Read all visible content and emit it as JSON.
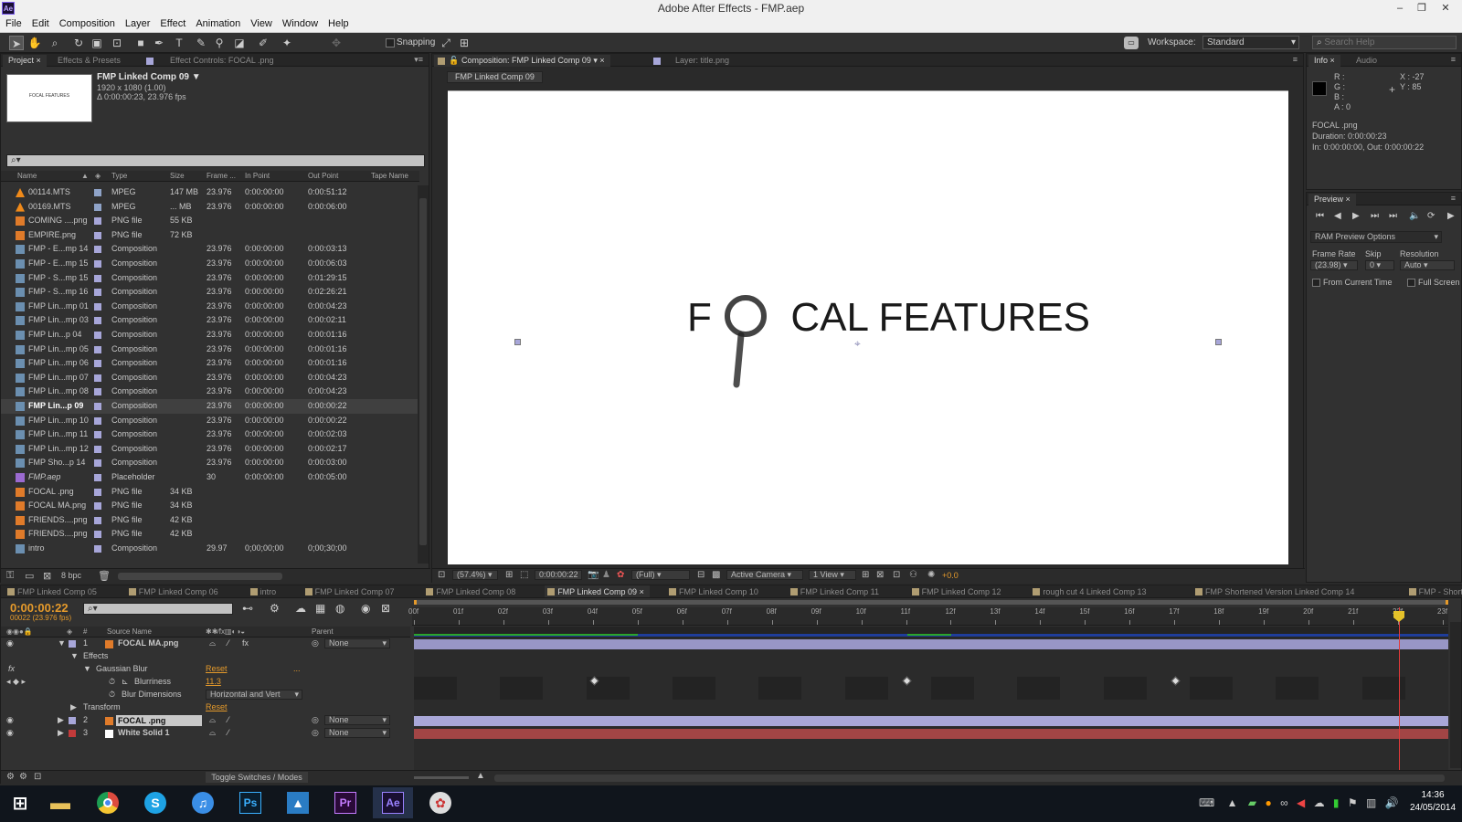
{
  "window": {
    "title": "Adobe After Effects - FMP.aep",
    "app_icon": "Ae"
  },
  "menu": [
    "File",
    "Edit",
    "Composition",
    "Layer",
    "Effect",
    "Animation",
    "View",
    "Window",
    "Help"
  ],
  "toolbar": {
    "snapping": "Snapping",
    "workspace_label": "Workspace:",
    "workspace_value": "Standard",
    "search_placeholder": "Search Help"
  },
  "project": {
    "tabs": [
      "Project",
      "Effects & Presets",
      "Effect Controls: FOCAL .png"
    ],
    "comp_name": "FMP Linked Comp 09 ▼",
    "comp_res": "1920 x 1080 (1.00)",
    "comp_dur": "Δ 0:00:00:23, 23.976 fps",
    "thumb_text": "FOCAL FEATURES",
    "search": "",
    "columns": [
      "Name",
      "Type",
      "Size",
      "Frame ...",
      "In Point",
      "Out Point",
      "Tape Name"
    ],
    "items": [
      {
        "name": "00114.MTS",
        "type": "MPEG",
        "size": "147 MB",
        "fps": "23.976",
        "in": "0:00:00:00",
        "out": "0:00:51:12",
        "icon": "cone-icon",
        "label": "#8fa3c8"
      },
      {
        "name": "00169.MTS",
        "type": "MPEG",
        "size": "... MB",
        "fps": "23.976",
        "in": "0:00:00:00",
        "out": "0:00:06:00",
        "icon": "cone-icon",
        "label": "#8fa3c8"
      },
      {
        "name": "COMING ....png",
        "type": "PNG file",
        "size": "55 KB",
        "fps": "",
        "in": "",
        "out": "",
        "icon": "png-icon",
        "label": "#a7a6d9"
      },
      {
        "name": "EMPIRE.png",
        "type": "PNG file",
        "size": "72 KB",
        "fps": "",
        "in": "",
        "out": "",
        "icon": "png-icon",
        "label": "#a7a6d9"
      },
      {
        "name": "FMP - E...mp 14",
        "type": "Composition",
        "size": "",
        "fps": "23.976",
        "in": "0:00:00:00",
        "out": "0:00:03:13",
        "icon": "comp-icon",
        "label": "#a7a6d9"
      },
      {
        "name": "FMP - E...mp 15",
        "type": "Composition",
        "size": "",
        "fps": "23.976",
        "in": "0:00:00:00",
        "out": "0:00:06:03",
        "icon": "comp-icon",
        "label": "#a7a6d9"
      },
      {
        "name": "FMP - S...mp 15",
        "type": "Composition",
        "size": "",
        "fps": "23.976",
        "in": "0:00:00:00",
        "out": "0:01:29:15",
        "icon": "comp-icon",
        "label": "#a7a6d9"
      },
      {
        "name": "FMP - S...mp 16",
        "type": "Composition",
        "size": "",
        "fps": "23.976",
        "in": "0:00:00:00",
        "out": "0:02:26:21",
        "icon": "comp-icon",
        "label": "#a7a6d9"
      },
      {
        "name": "FMP Lin...mp 01",
        "type": "Composition",
        "size": "",
        "fps": "23.976",
        "in": "0:00:00:00",
        "out": "0:00:04:23",
        "icon": "comp-icon",
        "label": "#a7a6d9"
      },
      {
        "name": "FMP Lin...mp 03",
        "type": "Composition",
        "size": "",
        "fps": "23.976",
        "in": "0:00:00:00",
        "out": "0:00:02:11",
        "icon": "comp-icon",
        "label": "#a7a6d9"
      },
      {
        "name": "FMP Lin...p 04",
        "type": "Composition",
        "size": "",
        "fps": "23.976",
        "in": "0:00:00:00",
        "out": "0:00:01:16",
        "icon": "comp-icon",
        "label": "#a7a6d9"
      },
      {
        "name": "FMP Lin...mp 05",
        "type": "Composition",
        "size": "",
        "fps": "23.976",
        "in": "0:00:00:00",
        "out": "0:00:01:16",
        "icon": "comp-icon",
        "label": "#a7a6d9"
      },
      {
        "name": "FMP Lin...mp 06",
        "type": "Composition",
        "size": "",
        "fps": "23.976",
        "in": "0:00:00:00",
        "out": "0:00:01:16",
        "icon": "comp-icon",
        "label": "#a7a6d9"
      },
      {
        "name": "FMP Lin...mp 07",
        "type": "Composition",
        "size": "",
        "fps": "23.976",
        "in": "0:00:00:00",
        "out": "0:00:04:23",
        "icon": "comp-icon",
        "label": "#a7a6d9"
      },
      {
        "name": "FMP Lin...mp 08",
        "type": "Composition",
        "size": "",
        "fps": "23.976",
        "in": "0:00:00:00",
        "out": "0:00:04:23",
        "icon": "comp-icon",
        "label": "#a7a6d9"
      },
      {
        "name": "FMP Lin...p 09",
        "type": "Composition",
        "size": "",
        "fps": "23.976",
        "in": "0:00:00:00",
        "out": "0:00:00:22",
        "icon": "comp-icon",
        "label": "#a7a6d9",
        "selected": true
      },
      {
        "name": "FMP Lin...mp 10",
        "type": "Composition",
        "size": "",
        "fps": "23.976",
        "in": "0:00:00:00",
        "out": "0:00:00:22",
        "icon": "comp-icon",
        "label": "#a7a6d9"
      },
      {
        "name": "FMP Lin...mp 11",
        "type": "Composition",
        "size": "",
        "fps": "23.976",
        "in": "0:00:00:00",
        "out": "0:00:02:03",
        "icon": "comp-icon",
        "label": "#a7a6d9"
      },
      {
        "name": "FMP Lin...mp 12",
        "type": "Composition",
        "size": "",
        "fps": "23.976",
        "in": "0:00:00:00",
        "out": "0:00:02:17",
        "icon": "comp-icon",
        "label": "#a7a6d9"
      },
      {
        "name": "FMP Sho...p 14",
        "type": "Composition",
        "size": "",
        "fps": "23.976",
        "in": "0:00:00:00",
        "out": "0:00:03:00",
        "icon": "comp-icon",
        "label": "#a7a6d9"
      },
      {
        "name": "FMP.aep",
        "type": "Placeholder",
        "size": "",
        "fps": "30",
        "in": "0:00:00:00",
        "out": "0:00:05:00",
        "icon": "placeholder-icon",
        "label": "#a7a6d9"
      },
      {
        "name": "FOCAL .png",
        "type": "PNG file",
        "size": "34 KB",
        "fps": "",
        "in": "",
        "out": "",
        "icon": "png-icon",
        "label": "#a7a6d9"
      },
      {
        "name": "FOCAL MA.png",
        "type": "PNG file",
        "size": "34 KB",
        "fps": "",
        "in": "",
        "out": "",
        "icon": "png-icon",
        "label": "#a7a6d9"
      },
      {
        "name": "FRIENDS....png",
        "type": "PNG file",
        "size": "42 KB",
        "fps": "",
        "in": "",
        "out": "",
        "icon": "png-icon",
        "label": "#a7a6d9"
      },
      {
        "name": "FRIENDS....png",
        "type": "PNG file",
        "size": "42 KB",
        "fps": "",
        "in": "",
        "out": "",
        "icon": "png-icon",
        "label": "#a7a6d9"
      },
      {
        "name": "intro",
        "type": "Composition",
        "size": "",
        "fps": "29.97",
        "in": "0;00;00;00",
        "out": "0;00;30;00",
        "icon": "comp-icon",
        "label": "#a7a6d9"
      }
    ],
    "bpc": "8 bpc"
  },
  "comp": {
    "tabs": [
      "Composition: FMP Linked Comp 09",
      "Layer: title.png"
    ],
    "breadcrumb": "FMP Linked Comp 09",
    "canvas_text_left": "F",
    "canvas_text_right": "CAL FEATURES",
    "zoom": "(57.4%)",
    "timecode": "0:00:00:22",
    "resolution": "(Full)",
    "camera": "Active Camera",
    "views": "1 View",
    "exposure": "+0.0"
  },
  "info": {
    "tabs": [
      "Info",
      "Audio"
    ],
    "r": "R :",
    "g": "G :",
    "b": "B :",
    "a": "A : 0",
    "x": "X : -27",
    "y": "Y : 85",
    "layer": "FOCAL .png",
    "duration": "Duration: 0:00:00:23",
    "inout": "In: 0:00:00:00, Out: 0:00:00:22"
  },
  "preview": {
    "tab": "Preview",
    "ram": "RAM Preview Options",
    "frame_rate_label": "Frame Rate",
    "skip_label": "Skip",
    "resolution_label": "Resolution",
    "frame_rate": "(23.98)",
    "skip": "0",
    "resolution": "Auto",
    "from_current": "From Current Time",
    "full_screen": "Full Screen"
  },
  "timeline": {
    "tabs": [
      "FMP Linked Comp 05",
      "FMP Linked Comp 06",
      "intro",
      "FMP Linked Comp 07",
      "FMP Linked Comp 08",
      "FMP Linked Comp 09",
      "FMP Linked Comp 10",
      "FMP Linked Comp 11",
      "FMP Linked Comp 12",
      "rough cut 4 Linked Comp 13",
      "FMP Shortened Version Linked Comp 14",
      "FMP - Shortened Version Linkec"
    ],
    "active_tab": 5,
    "timecode": "0:00:00:22",
    "frames": "00022 (23.976 fps)",
    "source_name_header": "Source Name",
    "parent_header": "Parent",
    "ticks": [
      "00f",
      "01f",
      "02f",
      "03f",
      "04f",
      "05f",
      "06f",
      "07f",
      "08f",
      "09f",
      "10f",
      "11f",
      "12f",
      "13f",
      "14f",
      "15f",
      "16f",
      "17f",
      "18f",
      "19f",
      "20f",
      "21f",
      "22f",
      "23f"
    ],
    "layer1": {
      "num": "1",
      "name": "FOCAL MA.png",
      "parent": "None",
      "label": "#a7a6d9"
    },
    "effects": "Effects",
    "gaussian": "Gaussian Blur",
    "reset": "Reset",
    "dots": "...",
    "blurriness_label": "Blurriness",
    "blurriness_value": "11.3",
    "blur_dim_label": "Blur Dimensions",
    "blur_dim_value": "Horizontal and Vert",
    "transform": "Transform",
    "layer2": {
      "num": "2",
      "name": "FOCAL .png",
      "parent": "None",
      "label": "#a7a6d9"
    },
    "layer3": {
      "num": "3",
      "name": "White Solid 1",
      "parent": "None",
      "label": "#c23a3a"
    },
    "toggle": "Toggle Switches / Modes"
  },
  "taskbar": {
    "time": "14:36",
    "date": "24/05/2014",
    "apps": [
      "windows-start-icon",
      "file-explorer-icon",
      "chrome-icon",
      "skype-icon",
      "itunes-icon",
      "photoshop-icon",
      "photo-viewer-icon",
      "premiere-icon",
      "after-effects-icon",
      "flower-app-icon"
    ],
    "labels": {
      "ps": "Ps",
      "pr": "Pr",
      "ae": "Ae",
      "s": "S"
    }
  }
}
